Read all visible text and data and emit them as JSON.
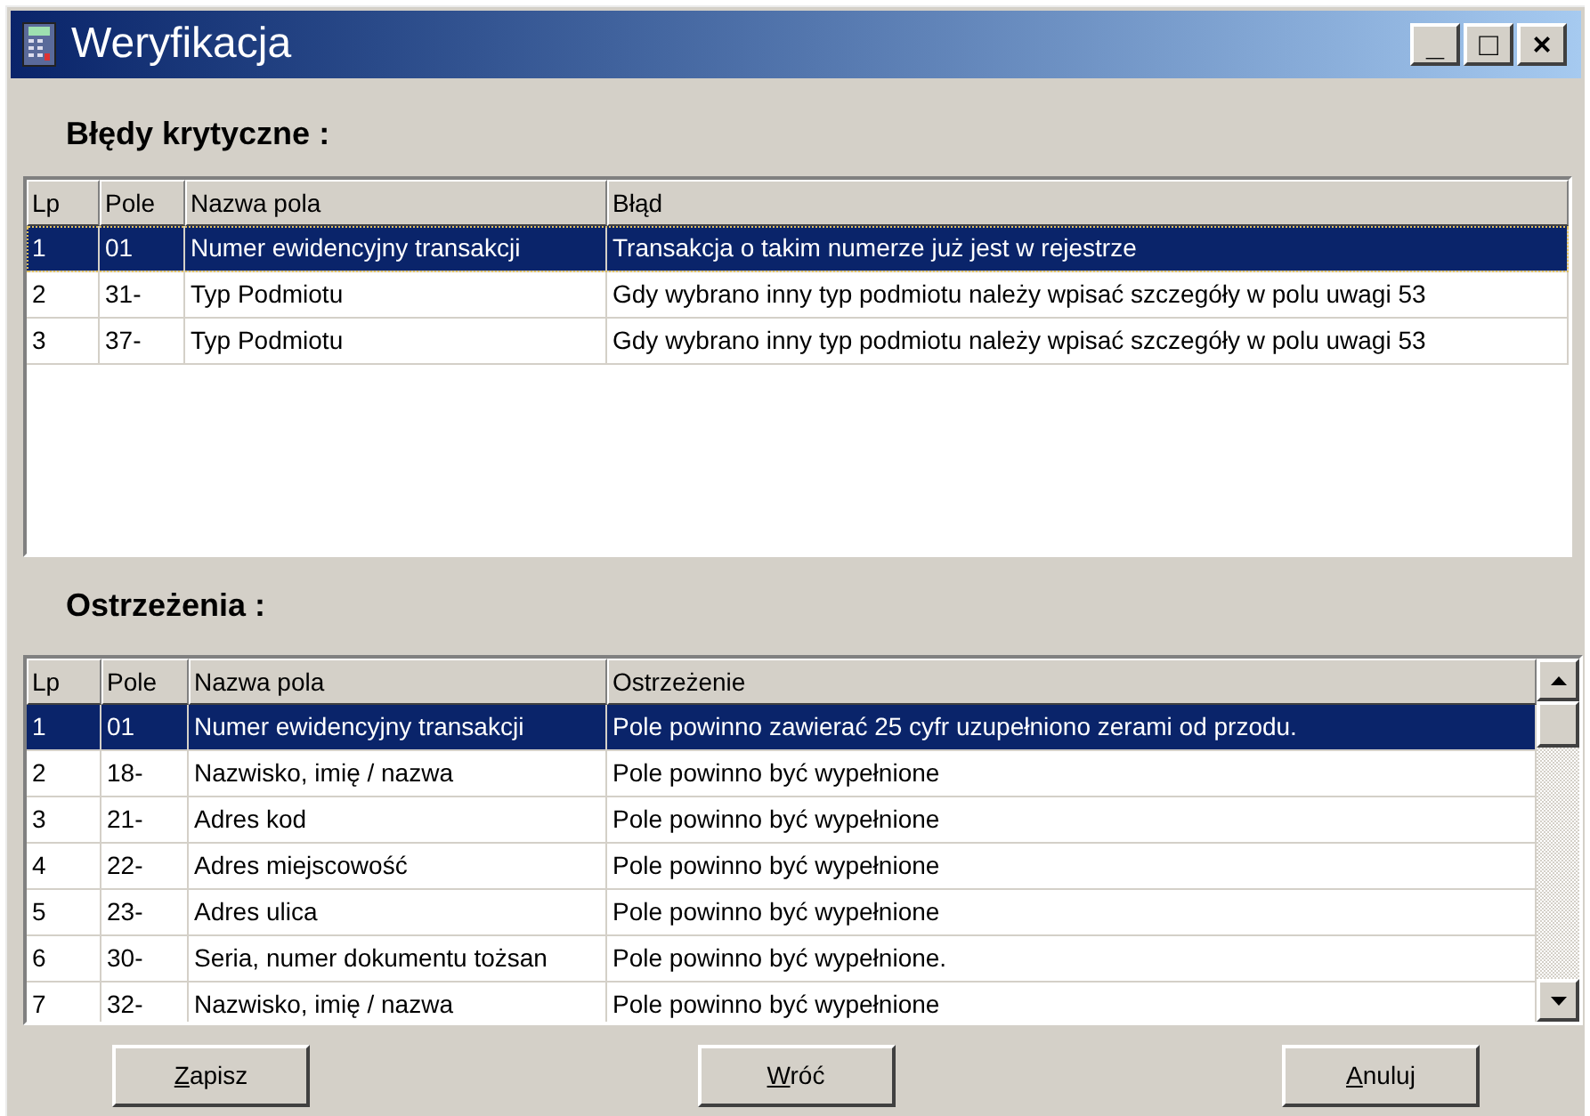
{
  "window": {
    "title": "Weryfikacja",
    "controls": [
      "_",
      "□",
      "×"
    ]
  },
  "errors": {
    "heading": "Błędy krytyczne :",
    "columns": [
      "Lp",
      "Pole",
      "Nazwa pola",
      "Błąd"
    ],
    "rows": [
      {
        "cells": [
          "1",
          "01",
          "Numer ewidencyjny transakcji",
          "Transakcja o takim numerze już jest w rejestrze"
        ],
        "selected": true
      },
      {
        "cells": [
          "2",
          "31-",
          "Typ Podmiotu",
          "Gdy wybrano inny typ podmiotu należy wpisać szczegóły w polu uwagi 53"
        ],
        "selected": false
      },
      {
        "cells": [
          "3",
          "37-",
          "Typ Podmiotu",
          "Gdy wybrano inny typ podmiotu należy wpisać szczegóły w polu uwagi 53"
        ],
        "selected": false
      }
    ]
  },
  "warnings": {
    "heading": "Ostrzeżenia :",
    "columns": [
      "Lp",
      "Pole",
      "Nazwa pola",
      "Ostrzeżenie"
    ],
    "rows": [
      {
        "cells": [
          "1",
          "01",
          "Numer ewidencyjny transakcji",
          "Pole powinno zawierać 25 cyfr uzupełniono zerami od przodu."
        ],
        "selected": true
      },
      {
        "cells": [
          "2",
          "18-",
          "Nazwisko, imię / nazwa",
          "Pole powinno być wypełnione"
        ],
        "selected": false
      },
      {
        "cells": [
          "3",
          "21-",
          "Adres kod",
          "Pole powinno być wypełnione"
        ],
        "selected": false
      },
      {
        "cells": [
          "4",
          "22-",
          "Adres miejscowość",
          "Pole powinno być wypełnione"
        ],
        "selected": false
      },
      {
        "cells": [
          "5",
          "23-",
          "Adres ulica",
          "Pole powinno być wypełnione"
        ],
        "selected": false
      },
      {
        "cells": [
          "6",
          "30-",
          "Seria, numer dokumentu tożsan",
          "Pole powinno być wypełnione."
        ],
        "selected": false
      },
      {
        "cells": [
          "7",
          "32-",
          "Nazwisko, imię / nazwa",
          "Pole powinno być wypełnione"
        ],
        "selected": false
      }
    ]
  },
  "buttons": [
    {
      "label": "Zapisz",
      "mnemonic": true
    },
    {
      "label": "Wróć",
      "mnemonic": true
    },
    {
      "label": "Anuluj",
      "mnemonic": true
    }
  ]
}
